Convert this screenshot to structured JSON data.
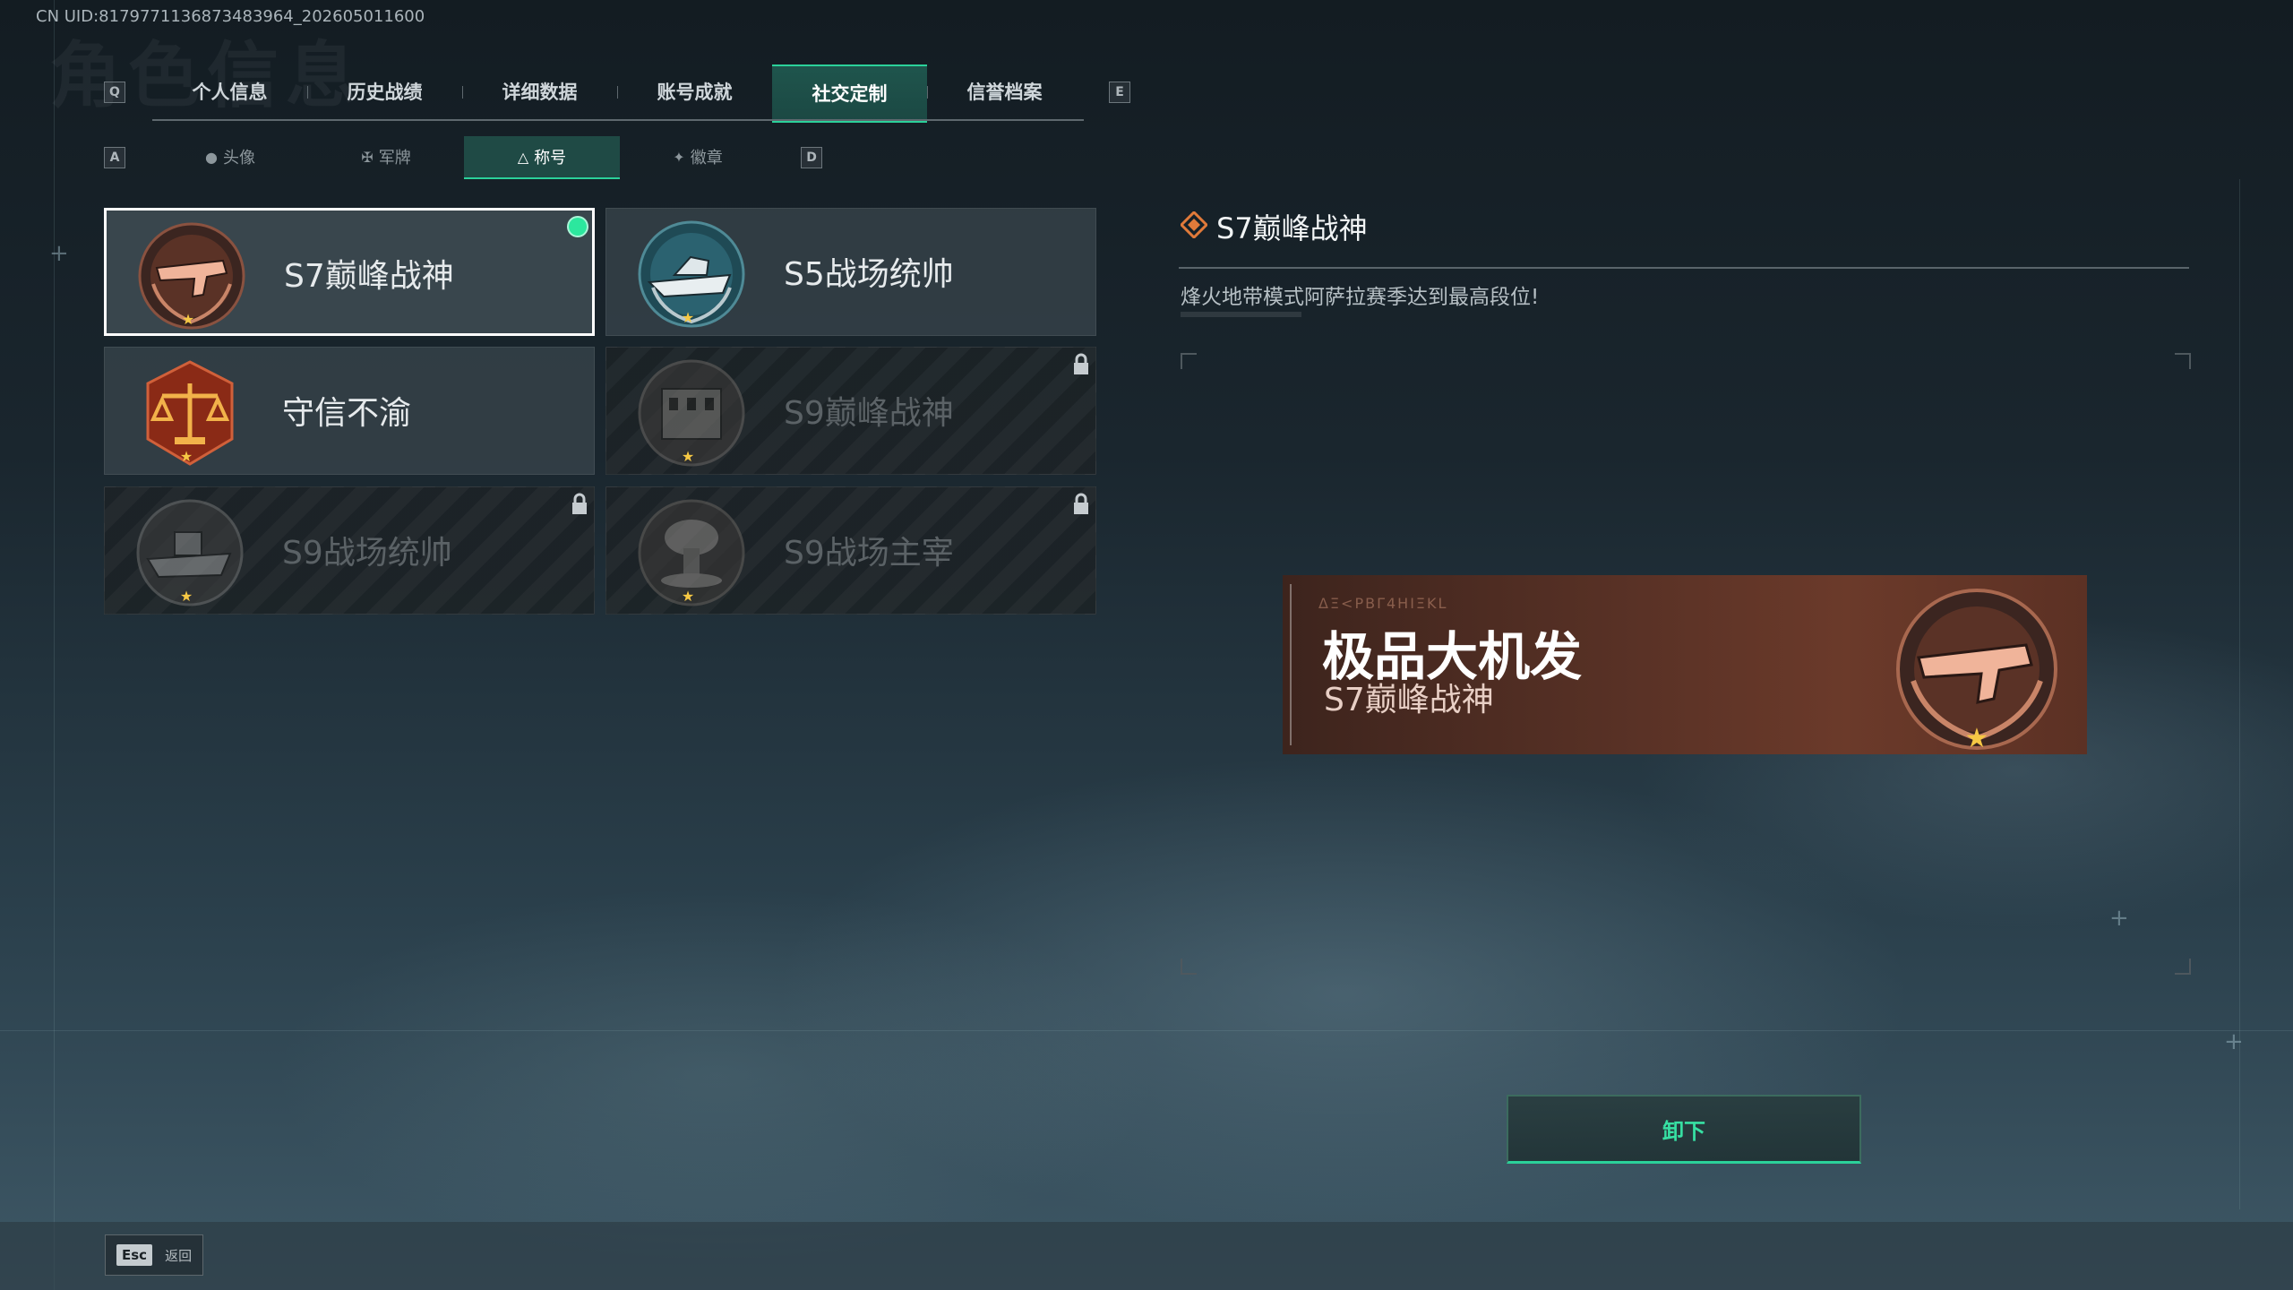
{
  "uid_text": "CN UID:8179771136873483964_202605011600",
  "bg_title": "角色信息",
  "keys": {
    "prev_tab": "Q",
    "next_tab": "E",
    "prev_sub": "A",
    "next_sub": "D"
  },
  "tabs": [
    {
      "label": "个人信息"
    },
    {
      "label": "历史战绩"
    },
    {
      "label": "详细数据"
    },
    {
      "label": "账号成就"
    },
    {
      "label": "社交定制"
    },
    {
      "label": "信誉档案"
    }
  ],
  "subtabs": [
    {
      "label": "头像",
      "icon": "person-icon"
    },
    {
      "label": "军牌",
      "icon": "dogtag-icon"
    },
    {
      "label": "称号",
      "icon": "title-icon"
    },
    {
      "label": "徽章",
      "icon": "badge-icon"
    }
  ],
  "titles": [
    {
      "name": "S7巅峰战神",
      "state": "equipped",
      "medal": "gun-medal"
    },
    {
      "name": "S5战场统帅",
      "state": "unlocked",
      "medal": "boat-medal"
    },
    {
      "name": "守信不渝",
      "state": "unlocked",
      "medal": "scales-medal"
    },
    {
      "name": "S9巅峰战神",
      "state": "locked",
      "medal": "building-medal"
    },
    {
      "name": "S9战场统帅",
      "state": "locked",
      "medal": "warship-medal"
    },
    {
      "name": "S9战场主宰",
      "state": "locked",
      "medal": "mushroom-cloud-medal"
    }
  ],
  "detail": {
    "title": "S7巅峰战神",
    "description": "烽火地带模式阿萨拉赛季达到最高段位!"
  },
  "preview": {
    "glyphs": "ΔΞ<ΡΒΓ4ΗΙΞΚL",
    "player_name": "极品大机发",
    "title": "S7巅峰战神"
  },
  "unequip_label": "卸下",
  "footer": {
    "esc_key": "Esc",
    "back_label": "返回"
  },
  "colors": {
    "accent": "#2bd19a",
    "equipped_dot": "#2ce79e",
    "banner": "#5a3226"
  }
}
